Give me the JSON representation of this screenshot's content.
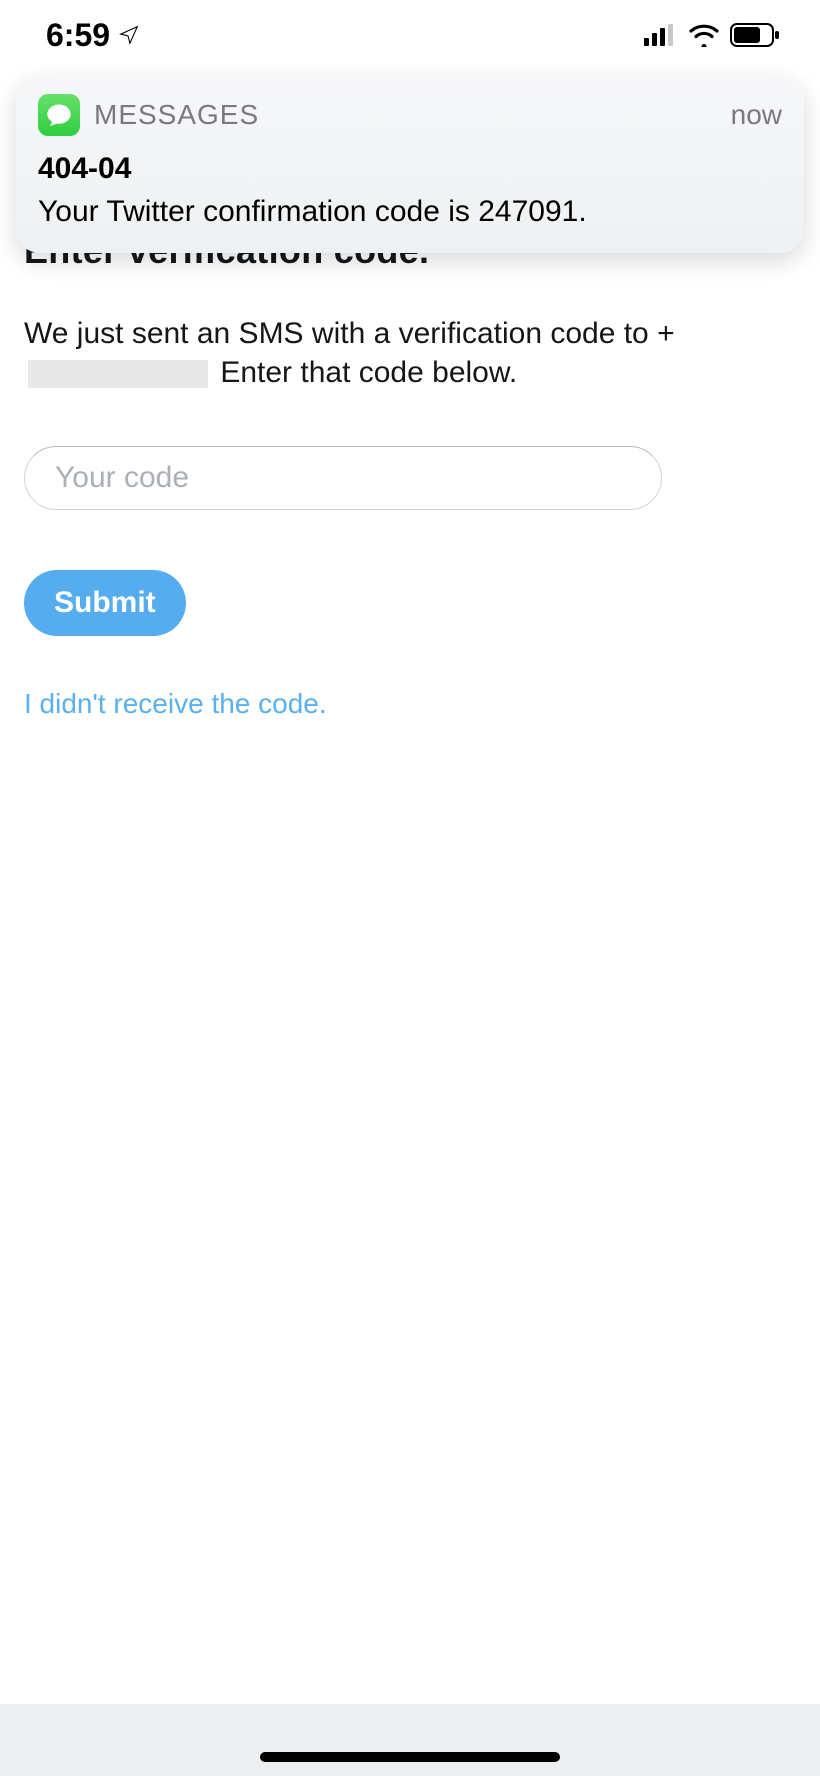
{
  "status": {
    "time": "6:59"
  },
  "notification": {
    "app_label": "MESSAGES",
    "time_label": "now",
    "sender": "404-04",
    "body": "Your Twitter confirmation code is 247091."
  },
  "page": {
    "heading": "Enter verification code.",
    "desc_part1": "We just sent an SMS with a verification code to +",
    "desc_part2": " Enter that code below.",
    "code_placeholder": "Your code",
    "submit_label": "Submit",
    "resend_label": "I didn't receive the code."
  }
}
